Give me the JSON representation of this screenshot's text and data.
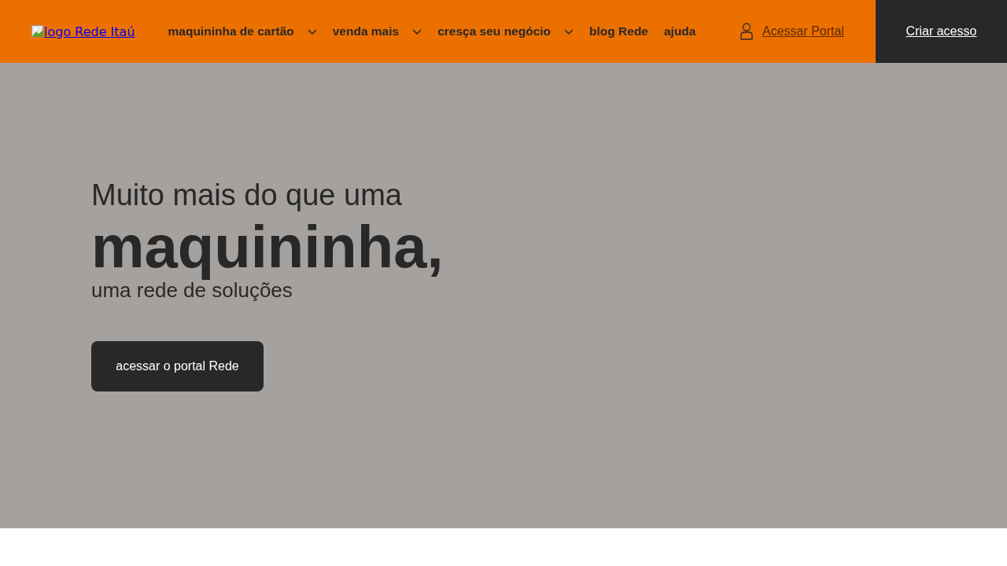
{
  "header": {
    "logo": {
      "alt_text": "logo Rede Itaú"
    },
    "nav": [
      {
        "label": "maquininha de cartão",
        "kind": "dropdown"
      },
      {
        "label": "venda mais",
        "kind": "dropdown"
      },
      {
        "label": "cresça seu negócio",
        "kind": "dropdown"
      },
      {
        "label": "blog Rede",
        "kind": "link"
      },
      {
        "label": "ajuda",
        "kind": "link"
      }
    ],
    "portal_link": {
      "label": "Acessar Portal"
    },
    "signup_button": {
      "label": "Criar acesso"
    }
  },
  "hero": {
    "kicker": "Muito mais do que uma",
    "headline": "maquininha,",
    "subline": "uma rede de soluções",
    "cta": {
      "label": "acessar o portal Rede"
    }
  }
}
